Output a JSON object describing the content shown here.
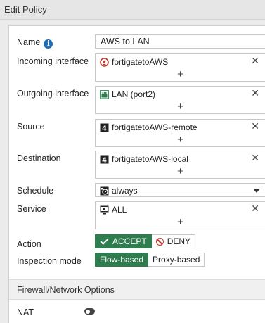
{
  "header": {
    "title": "Edit Policy"
  },
  "form": {
    "name": {
      "label": "Name",
      "value": "AWS to LAN"
    },
    "incoming_interface": {
      "label": "Incoming interface",
      "value": "fortigatetoAWS",
      "icon": "tunnel-interface-icon"
    },
    "outgoing_interface": {
      "label": "Outgoing interface",
      "value": "LAN (port2)",
      "icon": "port-interface-icon"
    },
    "source": {
      "label": "Source",
      "value": "fortigatetoAWS-remote",
      "icon": "address-group-icon"
    },
    "destination": {
      "label": "Destination",
      "value": "fortigatetoAWS-local",
      "icon": "address-group-icon"
    },
    "schedule": {
      "label": "Schedule",
      "value": "always",
      "icon": "schedule-icon"
    },
    "service": {
      "label": "Service",
      "value": "ALL",
      "icon": "service-icon"
    },
    "add_symbol": "+",
    "remove_symbol": "✕",
    "action": {
      "label": "Action",
      "options": [
        "ACCEPT",
        "DENY"
      ],
      "selected": "ACCEPT"
    },
    "inspection_mode": {
      "label": "Inspection mode",
      "options": [
        "Flow-based",
        "Proxy-based"
      ],
      "selected": "Flow-based"
    }
  },
  "section": {
    "title": "Firewall/Network Options"
  },
  "nat": {
    "label": "NAT",
    "enabled": false
  },
  "colors": {
    "accent_green": "#2e7d4f",
    "info_blue": "#1f6fb4",
    "deny_red": "#c0392b",
    "interface_red": "#c0392b"
  }
}
